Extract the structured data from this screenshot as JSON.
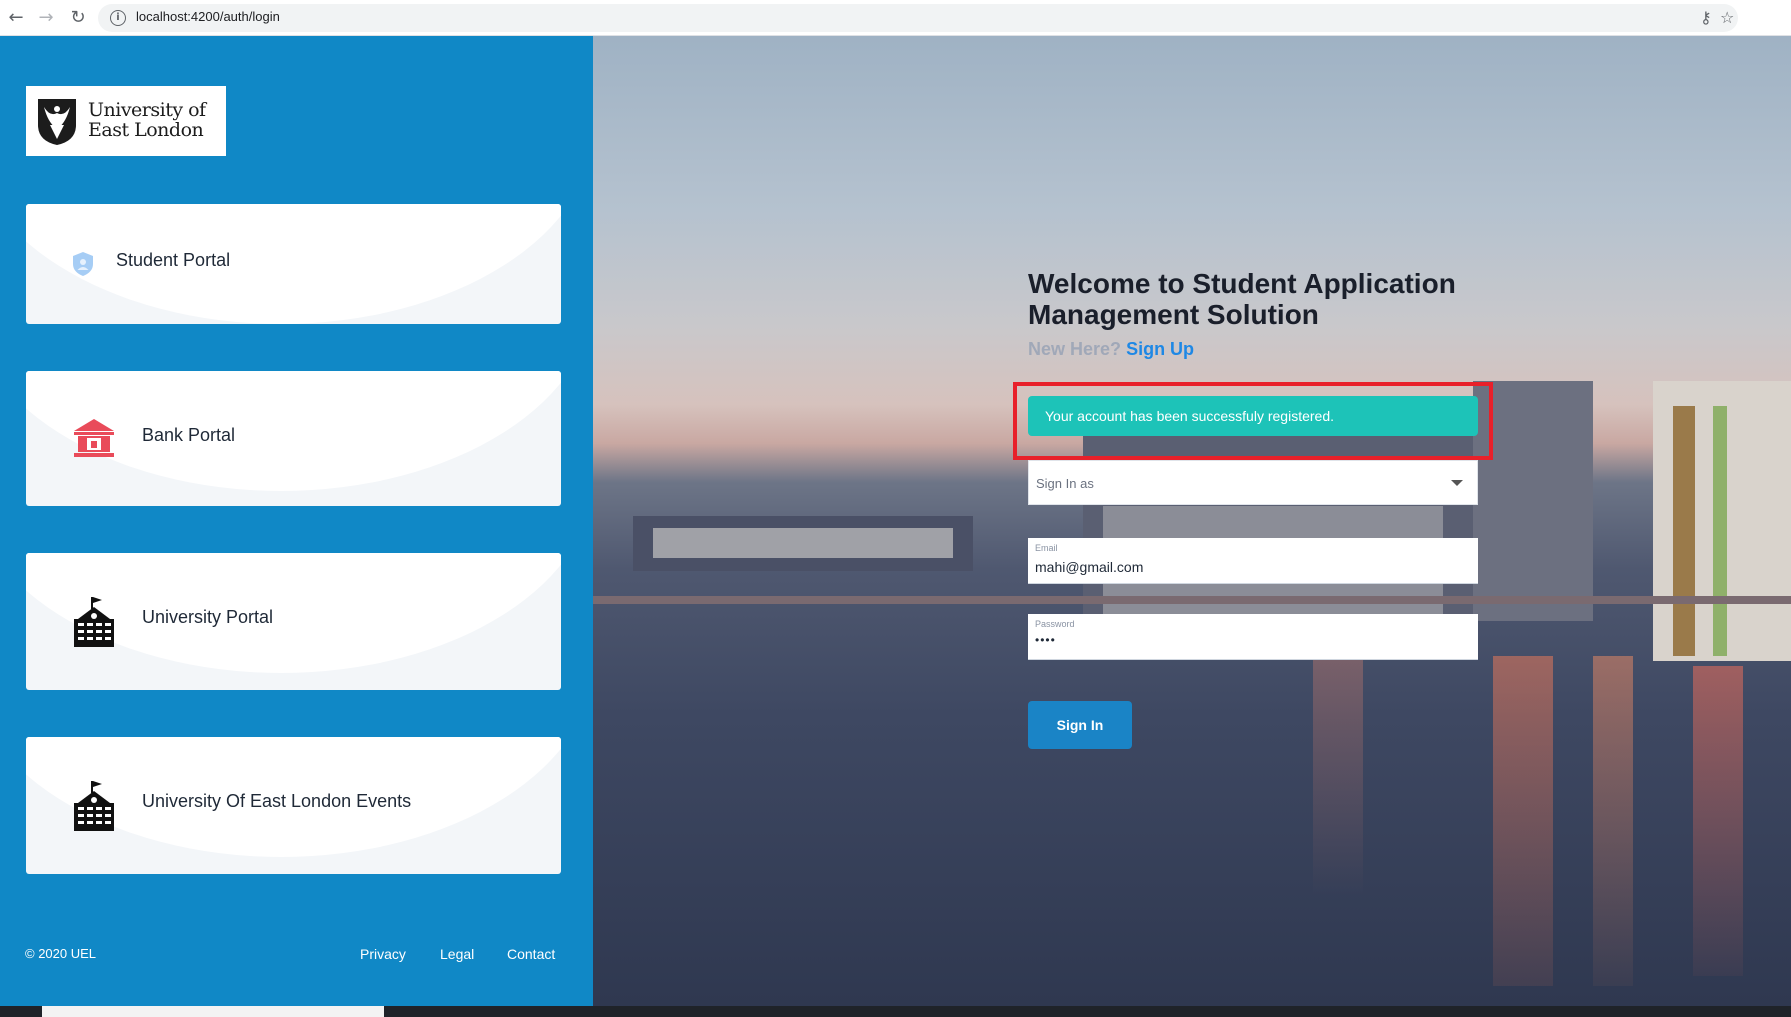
{
  "browser": {
    "url": "localhost:4200/auth/login",
    "info_glyph": "i"
  },
  "logo": {
    "line1": "University of",
    "line2": "East London"
  },
  "portals": [
    {
      "label": "Student Portal",
      "icon": "shield-user-icon",
      "color": "#a6cdf5"
    },
    {
      "label": "Bank Portal",
      "icon": "bank-icon",
      "color": "#e94b5a"
    },
    {
      "label": "University Portal",
      "icon": "school-building-icon",
      "color": "#111111"
    },
    {
      "label": "University Of East London Events",
      "icon": "school-building-icon",
      "color": "#111111"
    }
  ],
  "footer": {
    "copyright": "© 2020 UEL",
    "links": [
      "Privacy",
      "Legal",
      "Contact"
    ]
  },
  "login": {
    "title": "Welcome to Student Application Management Solution",
    "new_here": "New Here?",
    "signup": "Sign Up",
    "alert": "Your account has been successfuly registered.",
    "sign_in_as_placeholder": "Sign In as",
    "email_label": "Email",
    "email_value": "mahi@gmail.com",
    "password_label": "Password",
    "password_value": "••••",
    "submit_label": "Sign In"
  },
  "colors": {
    "left_panel": "#1088c6",
    "alert": "#1dc3b8",
    "button": "#1a84c6",
    "highlight": "#e8202a",
    "link": "#1e88e5"
  }
}
